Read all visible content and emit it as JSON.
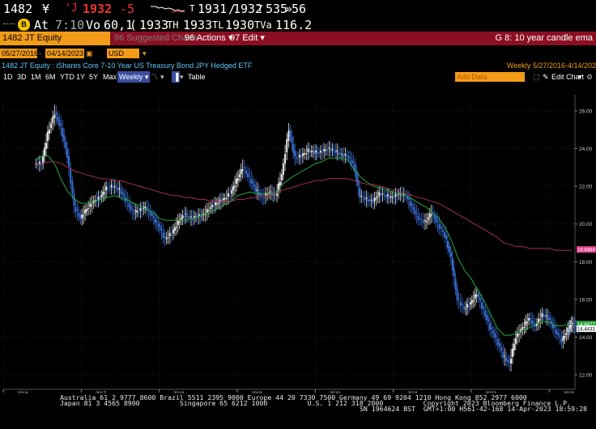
{
  "ticker": {
    "code": "1482",
    "currency": "¥",
    "tick": "'J",
    "last": "1932",
    "change": "-5",
    "open_tag": "T",
    "open": "1931",
    "bidask": "1932",
    "ask_tag": "T",
    "size": "535",
    "size_sep": "»",
    "size2": "56"
  },
  "quote": {
    "at_label": "At",
    "at_time": "7:10",
    "vo_label": "Vo",
    "volume": "60,1",
    "o_label": "(",
    "o_val": "1933",
    "h_label": "TH",
    "h_val": "1933",
    "l_label": "TL",
    "l_val": "1930",
    "va_label": "TVa",
    "va_val": "116.2"
  },
  "menubar": {
    "security": "1482 JT Equity",
    "suggested": "96 Suggested Charts",
    "actions": "Actions",
    "actions_num": "96",
    "edit": "Edit",
    "edit_num": "97",
    "graph_title": "G 8: 10 year candle ema"
  },
  "dates": {
    "start": "05/27/2016",
    "end": "04/14/2023",
    "currency": "USD"
  },
  "header": {
    "security_desc": "1482 JT Equity : iShares Core 7-10 Year US Treasury Bond JPY Hedged ETF",
    "period": "Weekly",
    "range": "5/27/2016-4/14/2023"
  },
  "toolbar": {
    "ranges": [
      "1D",
      "3D",
      "1M",
      "6M",
      "YTD",
      "1Y",
      "5Y",
      "Max"
    ],
    "frequency": "Weekly",
    "table_label": "Table",
    "add_data": "Add Data",
    "edit_chart": "Edit Chart"
  },
  "colors": {
    "price": "#3a6fd6",
    "ema_short": "#22a83a",
    "ema_long": "#a0324a",
    "menubar": "#8b0f22",
    "accent": "#f29b18"
  },
  "chart_data": {
    "type": "line",
    "title": "",
    "xlabel": "",
    "ylabel": "",
    "ylim": [
      11.4,
      26.6
    ],
    "yticks": [
      "26.00",
      "24.00",
      "22.00",
      "20.00",
      "18.00",
      "16.00",
      "14.00",
      "12.00"
    ],
    "xticks": [
      "2016",
      "2017",
      "2018",
      "2019",
      "2020",
      "2021",
      "2022",
      "2023"
    ],
    "last_labels": {
      "ema_long": "18.6484",
      "ema_short": "14.6877",
      "price": "14.4433"
    },
    "x": [
      2016.41,
      2016.5,
      2016.58,
      2016.67,
      2016.75,
      2016.83,
      2016.92,
      2017.0,
      2017.08,
      2017.17,
      2017.25,
      2017.33,
      2017.42,
      2017.5,
      2017.58,
      2017.67,
      2017.75,
      2017.83,
      2017.92,
      2018.0,
      2018.08,
      2018.17,
      2018.25,
      2018.33,
      2018.42,
      2018.5,
      2018.58,
      2018.67,
      2018.75,
      2018.83,
      2018.92,
      2019.0,
      2019.08,
      2019.17,
      2019.25,
      2019.33,
      2019.42,
      2019.5,
      2019.58,
      2019.67,
      2019.75,
      2019.83,
      2019.92,
      2020.0,
      2020.08,
      2020.17,
      2020.25,
      2020.33,
      2020.42,
      2020.5,
      2020.58,
      2020.67,
      2020.75,
      2020.83,
      2020.92,
      2021.0,
      2021.08,
      2021.17,
      2021.25,
      2021.33,
      2021.42,
      2021.5,
      2021.58,
      2021.67,
      2021.75,
      2021.83,
      2021.92,
      2022.0,
      2022.08,
      2022.17,
      2022.25,
      2022.33,
      2022.42,
      2022.5,
      2022.58,
      2022.67,
      2022.75,
      2022.83,
      2022.92,
      2023.0,
      2023.08,
      2023.17,
      2023.25,
      2023.29
    ],
    "series": [
      {
        "key": "price",
        "values": [
          23.2,
          24.8,
          25.9,
          25.1,
          23.6,
          20.9,
          20.3,
          20.8,
          21.2,
          21.4,
          21.9,
          22.0,
          21.8,
          21.3,
          20.6,
          20.7,
          20.9,
          20.4,
          19.9,
          19.2,
          19.5,
          20.1,
          20.5,
          20.3,
          20.4,
          20.5,
          20.9,
          21.1,
          21.3,
          21.6,
          22.3,
          23.0,
          22.4,
          21.8,
          21.4,
          21.7,
          21.5,
          22.6,
          25.0,
          23.5,
          23.6,
          23.9,
          23.8,
          23.8,
          24.0,
          23.9,
          23.7,
          23.6,
          23.2,
          21.5,
          21.3,
          21.2,
          21.6,
          21.5,
          21.4,
          21.6,
          21.5,
          20.9,
          20.3,
          20.1,
          20.6,
          20.0,
          19.4,
          18.2,
          16.0,
          15.5,
          15.8,
          16.3,
          15.4,
          14.5,
          13.9,
          13.0,
          12.6,
          14.0,
          14.5,
          15.0,
          14.6,
          15.2,
          15.0,
          14.4,
          13.8,
          14.4,
          14.7,
          14.5
        ]
      },
      {
        "key": "ema_short",
        "values": [
          23.4,
          23.6,
          23.6,
          23.1,
          22.3,
          21.7,
          21.3,
          21.1,
          21.1,
          21.2,
          21.3,
          21.4,
          21.5,
          21.4,
          21.3,
          21.1,
          21.0,
          20.8,
          20.6,
          20.3,
          20.2,
          20.2,
          20.2,
          20.2,
          20.3,
          20.4,
          20.5,
          20.7,
          20.8,
          21.0,
          21.2,
          21.5,
          21.6,
          21.7,
          21.6,
          21.6,
          21.6,
          21.6,
          22.1,
          22.4,
          22.6,
          22.8,
          23.0,
          23.2,
          23.3,
          23.5,
          23.5,
          23.5,
          23.4,
          22.9,
          22.5,
          22.2,
          22.0,
          21.9,
          21.8,
          21.7,
          21.6,
          21.5,
          21.3,
          21.1,
          20.9,
          20.6,
          20.3,
          19.8,
          19.1,
          18.2,
          17.5,
          17.1,
          16.5,
          15.9,
          15.2,
          14.5,
          14.1,
          14.1,
          14.2,
          14.4,
          14.5,
          14.7,
          14.8,
          14.8,
          14.6,
          14.6,
          14.7,
          14.7
        ]
      },
      {
        "key": "ema_long",
        "values": [
          23.1,
          23.2,
          23.3,
          23.3,
          23.2,
          23.0,
          22.8,
          22.7,
          22.6,
          22.5,
          22.4,
          22.4,
          22.3,
          22.3,
          22.2,
          22.1,
          22.0,
          21.9,
          21.8,
          21.7,
          21.6,
          21.5,
          21.5,
          21.4,
          21.4,
          21.3,
          21.3,
          21.2,
          21.2,
          21.2,
          21.2,
          21.3,
          21.3,
          21.4,
          21.4,
          21.5,
          21.5,
          21.6,
          21.8,
          21.9,
          22.0,
          22.1,
          22.2,
          22.3,
          22.3,
          22.4,
          22.4,
          22.4,
          22.4,
          22.3,
          22.2,
          22.1,
          22.1,
          22.0,
          21.9,
          21.8,
          21.7,
          21.6,
          21.5,
          21.4,
          21.3,
          21.2,
          21.1,
          20.9,
          20.7,
          20.5,
          20.3,
          20.1,
          19.9,
          19.7,
          19.5,
          19.3,
          19.0,
          18.9,
          18.8,
          18.8,
          18.7,
          18.7,
          18.7,
          18.7,
          18.6,
          18.6,
          18.6,
          18.6
        ]
      }
    ]
  },
  "footer": {
    "line1": "Australia 61 2 9777 8600 Brazil 5511 2395 9000 Europe 44 20 7330 7500 Germany 49 69 9204 1210 Hong Kong 852 2977 6000",
    "line2": "Japan 81 3 4565 8900          Singapore 65 6212 1000          U.S. 1 212 318 2000          Copyright 2023 Bloomberg Finance L.P.",
    "line3": "SN 1964624 BST  GMT+1:00 H561-42-168 14-Apr-2023 18:59:28"
  }
}
